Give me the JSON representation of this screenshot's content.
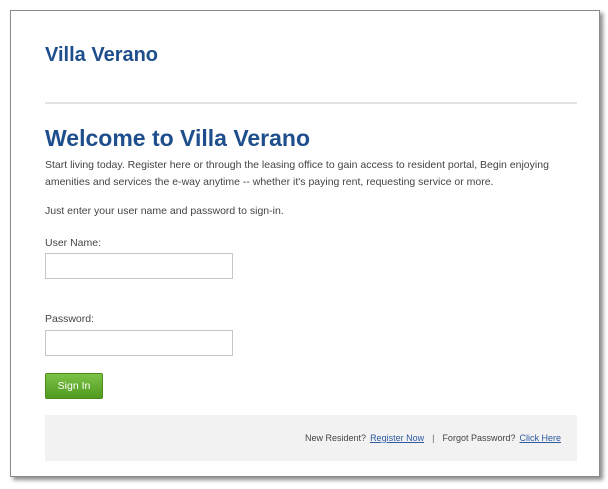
{
  "header": {
    "brand": "Villa Verano"
  },
  "main": {
    "title": "Welcome to Villa Verano",
    "intro": "Start living today. Register here or through the leasing office to gain access to resident portal, Begin enjoying amenities and services the e-way anytime -- whether it's paying rent, requesting service or more.",
    "instruction": "Just enter your user name and password to sign-in."
  },
  "form": {
    "username_label": "User Name:",
    "username_value": "",
    "password_label": "Password:",
    "password_value": "",
    "signin_label": "Sign In"
  },
  "footer": {
    "new_resident_text": "New Resident?",
    "register_link": "Register Now",
    "separator": "|",
    "forgot_text": "Forgot Password?",
    "click_here_link": "Click Here"
  },
  "colors": {
    "brand": "#1f4e8c",
    "button": "#5fa82e",
    "link": "#2d5aa0"
  }
}
